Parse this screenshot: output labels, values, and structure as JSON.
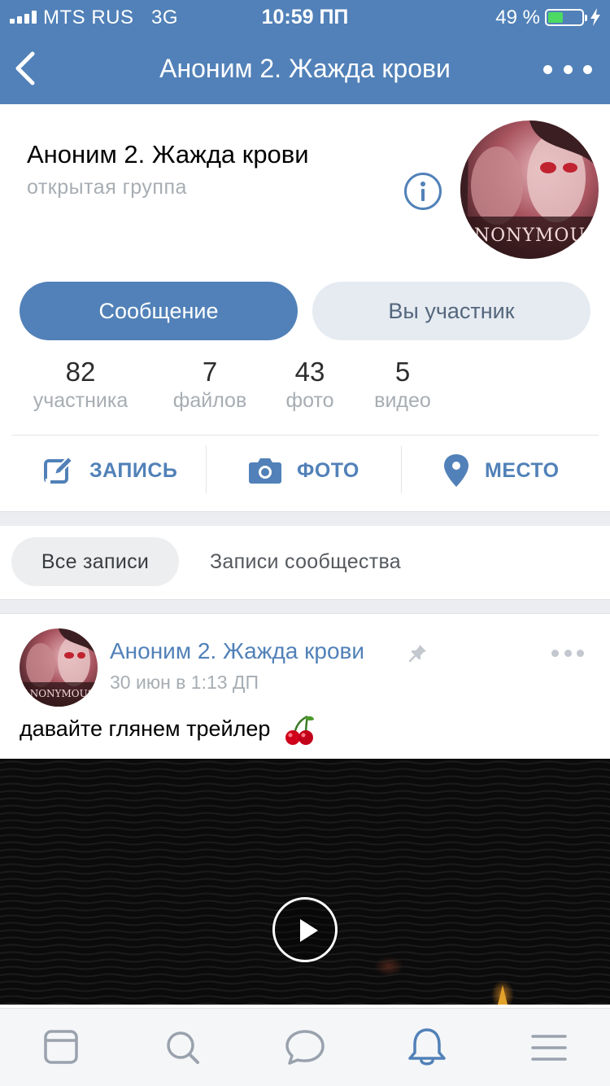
{
  "status_bar": {
    "carrier": "MTS RUS",
    "network": "3G",
    "time": "10:59 ПП",
    "battery_percent": "49 %",
    "battery_level": 0.49
  },
  "nav": {
    "title": "Аноним 2. Жажда крови"
  },
  "group": {
    "name": "Аноним 2. Жажда крови",
    "type": "открытая группа",
    "message_button": "Сообщение",
    "member_button": "Вы участник",
    "counters": [
      {
        "num": "82",
        "label": "участника"
      },
      {
        "num": "7",
        "label": "файлов"
      },
      {
        "num": "43",
        "label": "фото"
      },
      {
        "num": "5",
        "label": "видео"
      }
    ],
    "actions": [
      {
        "label": "ЗАПИСЬ",
        "icon": "edit-icon"
      },
      {
        "label": "ФОТО",
        "icon": "camera-icon"
      },
      {
        "label": "МЕСТО",
        "icon": "location-pin-icon"
      }
    ]
  },
  "feed_tabs": {
    "all": "Все записи",
    "community": "Записи сообщества"
  },
  "post": {
    "author": "Аноним 2. Жажда крови",
    "date": "30 июн в 1:13 ДП",
    "text": "давайте глянем трейлер",
    "emoji_icon": "cherry-icon",
    "pinned": true
  },
  "tabbar": {
    "items": [
      "news-icon",
      "search-icon",
      "messages-icon",
      "notifications-icon",
      "menu-icon"
    ],
    "active": "notifications-icon"
  },
  "colors": {
    "accent": "#5181b8",
    "secondary_button_bg": "#e5ebf1",
    "muted_text": "#a7adb3",
    "tabbar_bg": "#f5f6f8"
  }
}
